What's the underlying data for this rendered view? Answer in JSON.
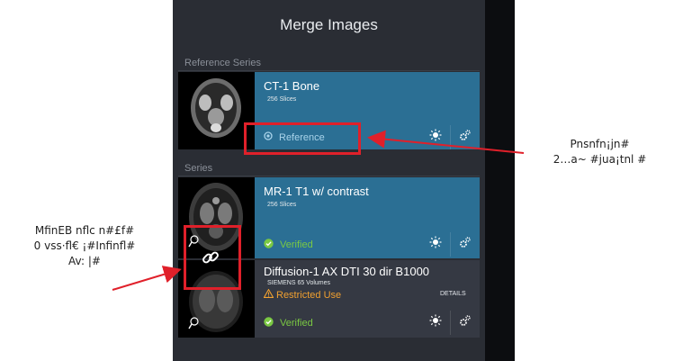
{
  "header": {
    "title": "Merge Images"
  },
  "reference_section": {
    "label": "Reference Series",
    "series": {
      "name": "CT-1 Bone",
      "slices": "256 Slices",
      "status_label": "Reference"
    }
  },
  "series_section": {
    "label": "Series",
    "items": [
      {
        "name": "MR-1 T1 w/ contrast",
        "slices": "256 Slices",
        "status_label": "Verified"
      },
      {
        "name": "Diffusion-1 AX DTI 30 dir B1000",
        "vendor_volumes": "SIEMENS 65 Volumes",
        "warning": "Restricted Use",
        "details_label": "DETAILS",
        "status_label": "Verified"
      }
    ]
  },
  "annotations": {
    "right": [
      "Pnsnfn¡jn#",
      "2…a~ #jua¡tnl #"
    ],
    "left": [
      "MfinEB nflc n#£f#",
      "0 vss·fl€ ¡#Infinfl#",
      "Av: |#"
    ]
  },
  "colors": {
    "panel_bg": "#2a2d34",
    "reference_blue": "#2b6f94",
    "verified_green": "#7ac943",
    "warning_orange": "#f0a030",
    "highlight_red": "#e0202a"
  }
}
